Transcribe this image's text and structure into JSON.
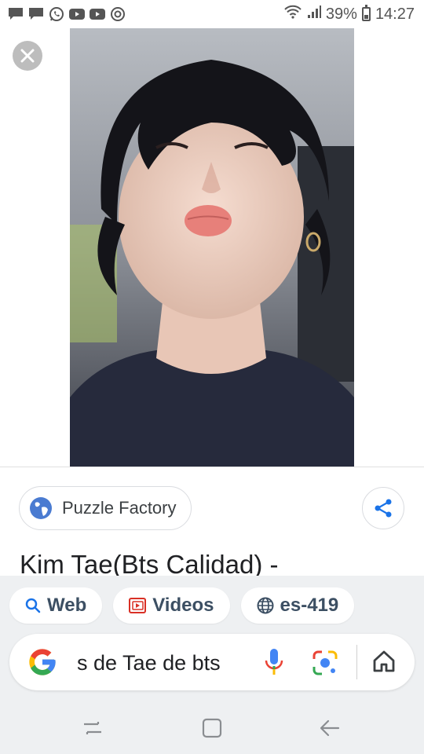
{
  "status_bar": {
    "notification_icons": [
      "chat-icon",
      "chat-icon",
      "whatsapp-icon",
      "youtube-icon",
      "youtube-icon",
      "camera-icon"
    ],
    "battery": "39%",
    "battery_level": 0.39,
    "time": "14:27"
  },
  "viewer": {
    "close_icon": "close-icon",
    "image_subject": "photo"
  },
  "source": {
    "name": "Puzzle Factory",
    "icon": "globe-icon",
    "share_icon": "share-icon"
  },
  "result": {
    "title": "Kim Tae(Bts Calidad) -"
  },
  "filter_chips": [
    {
      "label": "Web",
      "icon": "search-icon"
    },
    {
      "label": "Videos",
      "icon": "video-icon"
    },
    {
      "label": "es-419",
      "icon": "globe-icon"
    }
  ],
  "search_bar": {
    "query": "s de Tae de bts",
    "icons": [
      "google-logo",
      "mic-icon",
      "lens-icon",
      "home-icon"
    ]
  },
  "nav_bar": {
    "buttons": [
      "recents-button",
      "home-button",
      "back-button"
    ]
  },
  "colors": {
    "google_blue": "#4285F4",
    "google_red": "#EA4335",
    "google_yellow": "#FBBC05",
    "google_green": "#34A853",
    "chip_text": "#3c4f63",
    "panel_bg": "#eef0f2"
  }
}
